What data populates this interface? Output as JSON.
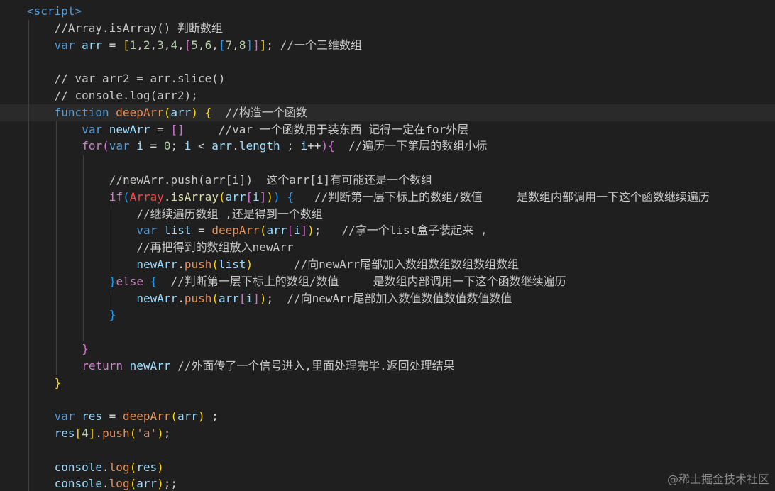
{
  "watermark": "@稀土掘金技术社区",
  "lines": [
    {
      "indent": 0,
      "tokens": [
        [
          "tag",
          "<script>"
        ]
      ]
    },
    {
      "indent": 1,
      "tokens": [
        [
          "comment",
          "//Array.isArray() 判断数组"
        ]
      ]
    },
    {
      "indent": 1,
      "tokens": [
        [
          "kw",
          "var"
        ],
        [
          "punct",
          " "
        ],
        [
          "var",
          "arr"
        ],
        [
          "punct",
          " = "
        ],
        [
          "brace1",
          "["
        ],
        [
          "num",
          "1"
        ],
        [
          "punct",
          ","
        ],
        [
          "num",
          "2"
        ],
        [
          "punct",
          ","
        ],
        [
          "num",
          "3"
        ],
        [
          "punct",
          ","
        ],
        [
          "num",
          "4"
        ],
        [
          "punct",
          ","
        ],
        [
          "brace2",
          "["
        ],
        [
          "num",
          "5"
        ],
        [
          "punct",
          ","
        ],
        [
          "num",
          "6"
        ],
        [
          "punct",
          ","
        ],
        [
          "brace3",
          "["
        ],
        [
          "num",
          "7"
        ],
        [
          "punct",
          ","
        ],
        [
          "num",
          "8"
        ],
        [
          "brace3",
          "]"
        ],
        [
          "brace2",
          "]"
        ],
        [
          "brace1",
          "]"
        ],
        [
          "punct",
          "; "
        ],
        [
          "comment",
          "//一个三维数组"
        ]
      ]
    },
    {
      "indent": 1,
      "tokens": []
    },
    {
      "indent": 1,
      "tokens": [
        [
          "comment",
          "// var arr2 = arr.slice()"
        ]
      ]
    },
    {
      "indent": 1,
      "tokens": [
        [
          "comment",
          "// console.log(arr2);"
        ]
      ]
    },
    {
      "indent": 1,
      "current": true,
      "tokens": [
        [
          "kw",
          "function"
        ],
        [
          "punct",
          " "
        ],
        [
          "func-orange",
          "deepArr"
        ],
        [
          "brace1",
          "("
        ],
        [
          "var",
          "arr"
        ],
        [
          "brace1",
          ")"
        ],
        [
          "punct",
          " "
        ],
        [
          "brace1",
          "{"
        ],
        [
          "punct",
          "  "
        ],
        [
          "comment",
          "//构造一个函数"
        ]
      ]
    },
    {
      "indent": 2,
      "tokens": [
        [
          "kw",
          "var"
        ],
        [
          "punct",
          " "
        ],
        [
          "var",
          "newArr"
        ],
        [
          "punct",
          " = "
        ],
        [
          "brace2",
          "[]"
        ],
        [
          "punct",
          "     "
        ],
        [
          "comment",
          "//var 一个函数用于装东西 记得一定在for外层"
        ]
      ]
    },
    {
      "indent": 2,
      "tokens": [
        [
          "ctrl",
          "for"
        ],
        [
          "brace2",
          "("
        ],
        [
          "kw",
          "var"
        ],
        [
          "punct",
          " "
        ],
        [
          "var",
          "i"
        ],
        [
          "punct",
          " = "
        ],
        [
          "num",
          "0"
        ],
        [
          "punct",
          "; "
        ],
        [
          "var",
          "i"
        ],
        [
          "punct",
          " < "
        ],
        [
          "var",
          "arr"
        ],
        [
          "punct",
          "."
        ],
        [
          "var",
          "length"
        ],
        [
          "punct",
          " ; "
        ],
        [
          "var",
          "i"
        ],
        [
          "punct",
          "++"
        ],
        [
          "brace2",
          ")"
        ],
        [
          "brace2",
          "{"
        ],
        [
          "punct",
          "  "
        ],
        [
          "comment",
          "//遍历一下第层的数组小标"
        ]
      ]
    },
    {
      "indent": 3,
      "tokens": []
    },
    {
      "indent": 3,
      "tokens": [
        [
          "comment",
          "//newArr.push(arr[i])  这个arr[i]有可能还是一个数组"
        ]
      ]
    },
    {
      "indent": 3,
      "tokens": [
        [
          "ctrl",
          "if"
        ],
        [
          "brace3",
          "("
        ],
        [
          "err",
          "Array"
        ],
        [
          "punct",
          "."
        ],
        [
          "func",
          "isArray"
        ],
        [
          "brace1",
          "("
        ],
        [
          "var",
          "arr"
        ],
        [
          "brace2",
          "["
        ],
        [
          "var",
          "i"
        ],
        [
          "brace2",
          "]"
        ],
        [
          "brace1",
          ")"
        ],
        [
          "brace3",
          ")"
        ],
        [
          "punct",
          " "
        ],
        [
          "brace3",
          "{"
        ],
        [
          "punct",
          "   "
        ],
        [
          "comment",
          "//判断第一层下标上的数组/数值     是数组内部调用一下这个函数继续遍历"
        ]
      ]
    },
    {
      "indent": 4,
      "tokens": [
        [
          "comment",
          "//继续遍历数组 ,还是得到一个数组"
        ]
      ]
    },
    {
      "indent": 4,
      "tokens": [
        [
          "kw",
          "var"
        ],
        [
          "punct",
          " "
        ],
        [
          "var",
          "list"
        ],
        [
          "punct",
          " = "
        ],
        [
          "func-orange",
          "deepArr"
        ],
        [
          "brace1",
          "("
        ],
        [
          "var",
          "arr"
        ],
        [
          "brace2",
          "["
        ],
        [
          "var",
          "i"
        ],
        [
          "brace2",
          "]"
        ],
        [
          "brace1",
          ")"
        ],
        [
          "punct",
          ";   "
        ],
        [
          "comment",
          "//拿一个list盒子装起来 ,"
        ]
      ]
    },
    {
      "indent": 4,
      "tokens": [
        [
          "comment",
          "//再把得到的数组放入newArr"
        ]
      ]
    },
    {
      "indent": 4,
      "tokens": [
        [
          "var",
          "newArr"
        ],
        [
          "punct",
          "."
        ],
        [
          "func-orange",
          "push"
        ],
        [
          "brace1",
          "("
        ],
        [
          "var",
          "list"
        ],
        [
          "brace1",
          ")"
        ],
        [
          "punct",
          "      "
        ],
        [
          "comment",
          "//向newArr尾部加入数组数组数组数组数组"
        ]
      ]
    },
    {
      "indent": 3,
      "tokens": [
        [
          "brace3",
          "}"
        ],
        [
          "ctrl",
          "else"
        ],
        [
          "punct",
          " "
        ],
        [
          "brace3",
          "{"
        ],
        [
          "punct",
          "  "
        ],
        [
          "comment",
          "//判断第一层下标上的数组/数值     是数组内部调用一下这个函数继续遍历"
        ]
      ]
    },
    {
      "indent": 4,
      "tokens": [
        [
          "var",
          "newArr"
        ],
        [
          "punct",
          "."
        ],
        [
          "func-orange",
          "push"
        ],
        [
          "brace1",
          "("
        ],
        [
          "var",
          "arr"
        ],
        [
          "brace2",
          "["
        ],
        [
          "var",
          "i"
        ],
        [
          "brace2",
          "]"
        ],
        [
          "brace1",
          ")"
        ],
        [
          "punct",
          ";  "
        ],
        [
          "comment",
          "//向newArr尾部加入数值数值数值数值数值"
        ]
      ]
    },
    {
      "indent": 3,
      "tokens": [
        [
          "brace3",
          "}"
        ]
      ]
    },
    {
      "indent": 3,
      "tokens": []
    },
    {
      "indent": 2,
      "tokens": [
        [
          "brace2",
          "}"
        ]
      ]
    },
    {
      "indent": 2,
      "tokens": [
        [
          "ctrl",
          "return"
        ],
        [
          "punct",
          " "
        ],
        [
          "var",
          "newArr"
        ],
        [
          "punct",
          " "
        ],
        [
          "comment",
          "//外面传了一个信号进入,里面处理完毕.返回处理结果"
        ]
      ]
    },
    {
      "indent": 1,
      "tokens": [
        [
          "brace1",
          "}"
        ]
      ]
    },
    {
      "indent": 1,
      "tokens": []
    },
    {
      "indent": 1,
      "tokens": [
        [
          "kw",
          "var"
        ],
        [
          "punct",
          " "
        ],
        [
          "var",
          "res"
        ],
        [
          "punct",
          " = "
        ],
        [
          "func-orange",
          "deepArr"
        ],
        [
          "brace1",
          "("
        ],
        [
          "var",
          "arr"
        ],
        [
          "brace1",
          ")"
        ],
        [
          "punct",
          " ;"
        ]
      ]
    },
    {
      "indent": 1,
      "tokens": [
        [
          "var",
          "res"
        ],
        [
          "brace1",
          "["
        ],
        [
          "num",
          "4"
        ],
        [
          "brace1",
          "]"
        ],
        [
          "punct",
          "."
        ],
        [
          "func-orange",
          "push"
        ],
        [
          "brace1",
          "("
        ],
        [
          "str",
          "'a'"
        ],
        [
          "brace1",
          ")"
        ],
        [
          "punct",
          ";"
        ]
      ]
    },
    {
      "indent": 1,
      "tokens": []
    },
    {
      "indent": 1,
      "tokens": [
        [
          "var",
          "console"
        ],
        [
          "punct",
          "."
        ],
        [
          "func-orange",
          "log"
        ],
        [
          "brace1",
          "("
        ],
        [
          "var",
          "res"
        ],
        [
          "brace1",
          ")"
        ]
      ]
    },
    {
      "indent": 1,
      "tokens": [
        [
          "var",
          "console"
        ],
        [
          "punct",
          "."
        ],
        [
          "func-orange",
          "log"
        ],
        [
          "brace1",
          "("
        ],
        [
          "var",
          "arr"
        ],
        [
          "brace1",
          ")"
        ],
        [
          "punct",
          ";;"
        ]
      ]
    }
  ]
}
